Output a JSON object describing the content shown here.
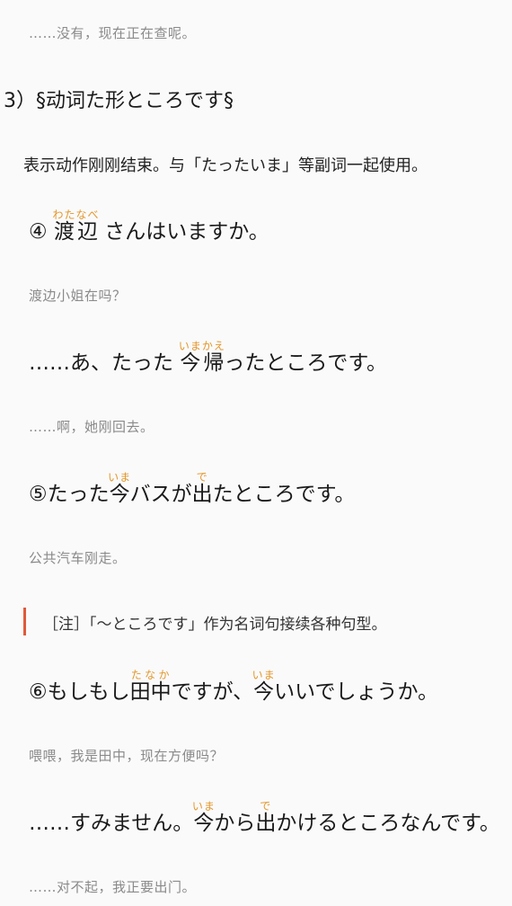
{
  "lines": {
    "t0": "……没有，现在正在查呢。",
    "heading": "3）§动词た形ところです§",
    "desc": "表示动作刚刚结束。与「たったいま」等副词一起使用。",
    "ex4": {
      "num": "④",
      "word": "渡辺",
      "word_rt": "わたなべ",
      "rest": "さんはいますか。"
    },
    "t4": "渡边小姐在吗？",
    "ex4b": {
      "pre": "……あ、たった",
      "w1": "今",
      "w1_rt": "いま",
      "w2": "帰",
      "w2_rt": "かえ",
      "rest": "ったところです。"
    },
    "t4b": "……啊，她刚回去。",
    "ex5": {
      "pre": "⑤たった",
      "w1": "今",
      "w1_rt": "いま",
      "mid": "バスが",
      "w2": "出",
      "w2_rt": "で",
      "rest": "たところです。"
    },
    "t5": "公共汽车刚走。",
    "note": "［注］「～ところです」作为名词句接续各种句型。",
    "ex6": {
      "pre": "⑥もしもし",
      "w1": "田中",
      "w1_rt": "たなか",
      "mid": "ですが、",
      "w2": "今",
      "w2_rt": "いま",
      "rest": "いいでしょうか。"
    },
    "t6": "喂喂，我是田中，现在方便吗？",
    "ex6b": {
      "pre": "……すみません。",
      "w1": "今",
      "w1_rt": "いま",
      "mid": "から",
      "w2": "出",
      "w2_rt": "で",
      "rest": "かけるところなんです。"
    },
    "t6b": "……对不起，我正要出门。"
  },
  "colors": {
    "furigana": "#e3962a",
    "note_bar": "#e05a3a",
    "translation": "#8a8a8a"
  }
}
